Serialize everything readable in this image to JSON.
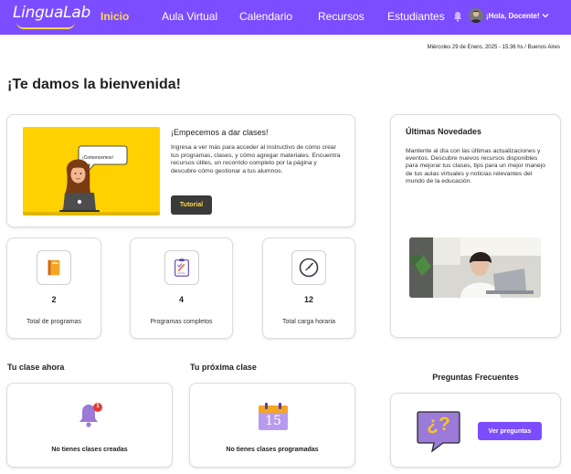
{
  "brand": {
    "name": "LinguaLab",
    "accent": "#7b4dff",
    "highlight": "#ffd84d"
  },
  "nav": {
    "items": [
      {
        "label": "Inicio",
        "active": true
      },
      {
        "label": "Aula Virtual",
        "active": false
      },
      {
        "label": "Calendario",
        "active": false
      },
      {
        "label": "Recursos",
        "active": false
      },
      {
        "label": "Estudiantes",
        "active": false
      }
    ],
    "greeting": "¡Hola, Docente!"
  },
  "datetime": "Miércoles 29 de Enero, 2025 - 15:36 hs / Buenos Aires",
  "welcome_title": "¡Te damos la bienvenida!",
  "hero": {
    "speech": "¡Comencemos!",
    "title": "¡Empecemos a dar clases!",
    "text": "Ingresa a ver más para acceder al instructivo de cómo crear tus programas, clases, y cómo agregar materiales. Encuentra recursos útiles, un recorrido completo por la página y descubre cómo gestionar a tus alumnos.",
    "button": "Tutorial"
  },
  "stats": [
    {
      "value": "2",
      "label": "Total de programas",
      "icon": "book-icon"
    },
    {
      "value": "4",
      "label": "Programas completos",
      "icon": "clipboard-check-icon"
    },
    {
      "value": "12",
      "label": "Total carga horaria",
      "icon": "clock-icon"
    }
  ],
  "news": {
    "title": "Últimas Novedades",
    "text": "Mantente al día con las últimas actualizaciones y eventos. Descubre nuevos recursos disponibles para mejorar tus clases, tips para un mejor manejo de tus aulas virtuales y noticias relevantes del mundo de la educación."
  },
  "current_class": {
    "title": "Tu clase ahora",
    "empty": "No tienes clases creadas",
    "badge": "1"
  },
  "next_class": {
    "title": "Tu próxima clase",
    "empty": "No tienes clases programadas",
    "calendar_day": "15"
  },
  "faq": {
    "title": "Preguntas Frecuentes",
    "button": "Ver preguntas",
    "glyph": "¿?"
  }
}
